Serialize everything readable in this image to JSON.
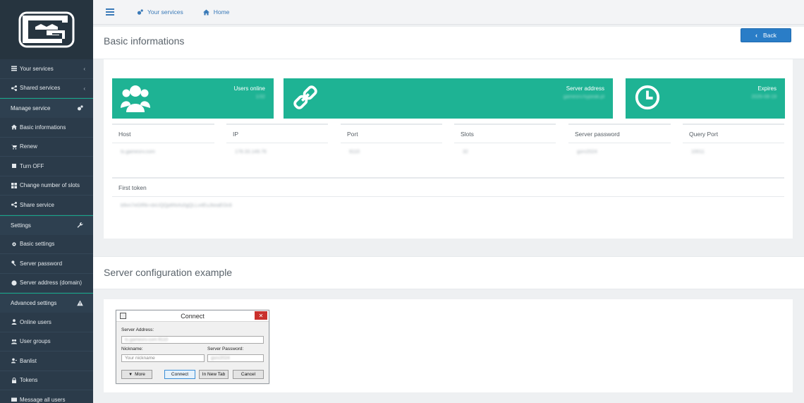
{
  "sidebar": {
    "items_top": [
      {
        "label": "Your services",
        "icon": "list-icon"
      },
      {
        "label": "Shared services",
        "icon": "share-icon"
      }
    ],
    "manage": {
      "title": "Manage service",
      "items": [
        {
          "label": "Basic informations",
          "icon": "home-icon"
        },
        {
          "label": "Renew",
          "icon": "cart-icon"
        },
        {
          "label": "Turn OFF",
          "icon": "stop-icon"
        },
        {
          "label": "Change number of slots",
          "icon": "grid-icon"
        },
        {
          "label": "Share service",
          "icon": "share-icon"
        }
      ]
    },
    "settings": {
      "title": "Settings",
      "items": [
        {
          "label": "Basic settings",
          "icon": "gear-icon"
        },
        {
          "label": "Server password",
          "icon": "key-icon"
        },
        {
          "label": "Server address (domain)",
          "icon": "globe-icon"
        }
      ]
    },
    "advanced": {
      "title": "Advanced settings",
      "items": [
        {
          "label": "Online users",
          "icon": "user-icon"
        },
        {
          "label": "User groups",
          "icon": "users-icon"
        },
        {
          "label": "Banlist",
          "icon": "user-ban-icon"
        },
        {
          "label": "Tokens",
          "icon": "lock-icon"
        },
        {
          "label": "Message all users",
          "icon": "envelope-icon"
        }
      ]
    }
  },
  "topbar": {
    "services": "Your services",
    "home": "Home"
  },
  "basic": {
    "title": "Basic informations",
    "back": "Back",
    "stats": [
      {
        "label": "Users online",
        "value": "1/32"
      },
      {
        "label": "Server address",
        "value": "gamesrv.hypeak.pl"
      },
      {
        "label": "Expires",
        "value": "2026-08-19"
      }
    ],
    "columns": [
      {
        "header": "Host",
        "value": "ts.gamesrv.com"
      },
      {
        "header": "IP",
        "value": "178.33.149.76"
      },
      {
        "header": "Port",
        "value": "9110"
      },
      {
        "header": "Slots",
        "value": "32"
      },
      {
        "header": "Server password",
        "value": "gsrv2024"
      },
      {
        "header": "Query Port",
        "value": "10011"
      }
    ],
    "token": {
      "header": "First token",
      "value": "b9vn7eGfRk+dxUQQp6Nvfu0gQLLx4EuJkeaEOc8"
    }
  },
  "config": {
    "title": "Server configuration example",
    "dialog": {
      "title": "Connect",
      "server_address_label": "Server Address:",
      "server_address_value": "ts.gamesrv.com:9110",
      "nickname_label": "Nickname:",
      "nickname_placeholder": "Your nickname",
      "password_label": "Server Password:",
      "password_value": "gsrv2024",
      "more": "More",
      "connect": "Connect",
      "new_tab": "In New Tab",
      "cancel": "Cancel"
    }
  }
}
